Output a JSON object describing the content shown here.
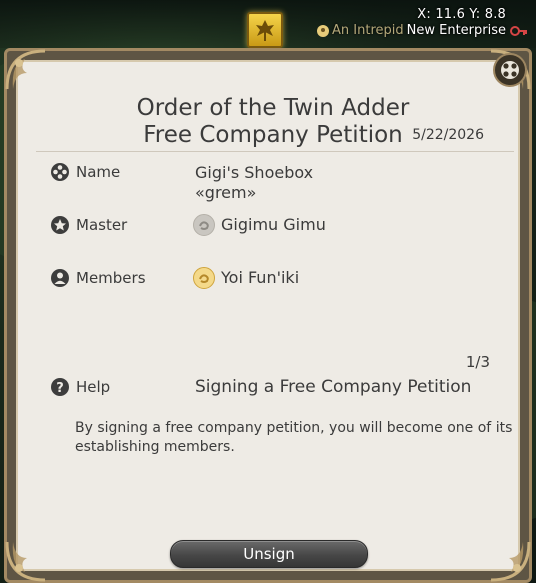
{
  "hud": {
    "coordinates": "X: 11.6 Y: 8.8",
    "location_prefix": "An Intrepid",
    "location_name": "New Enterprise"
  },
  "window": {
    "title_line1": "Order of the Twin Adder",
    "title_line2": "Free Company Petition",
    "date": "5/22/2026"
  },
  "fields": {
    "name_label": "Name",
    "name_value": "Gigi's Shoebox",
    "tag_value": "«grem»",
    "master_label": "Master",
    "master_value": "Gigimu Gimu",
    "members_label": "Members",
    "members": [
      "Yoi Fun'iki"
    ]
  },
  "pagination": "1/3",
  "help": {
    "label": "Help",
    "title": "Signing a Free Company Petition",
    "body": "By signing a free company petition, you will become one of its establishing members."
  },
  "actions": {
    "unsign_label": "Unsign"
  },
  "colors": {
    "panel_bg": "#eeebe5",
    "frame": "#a38a63",
    "text": "#3b3b3b",
    "crest": "#e8bf2a"
  }
}
